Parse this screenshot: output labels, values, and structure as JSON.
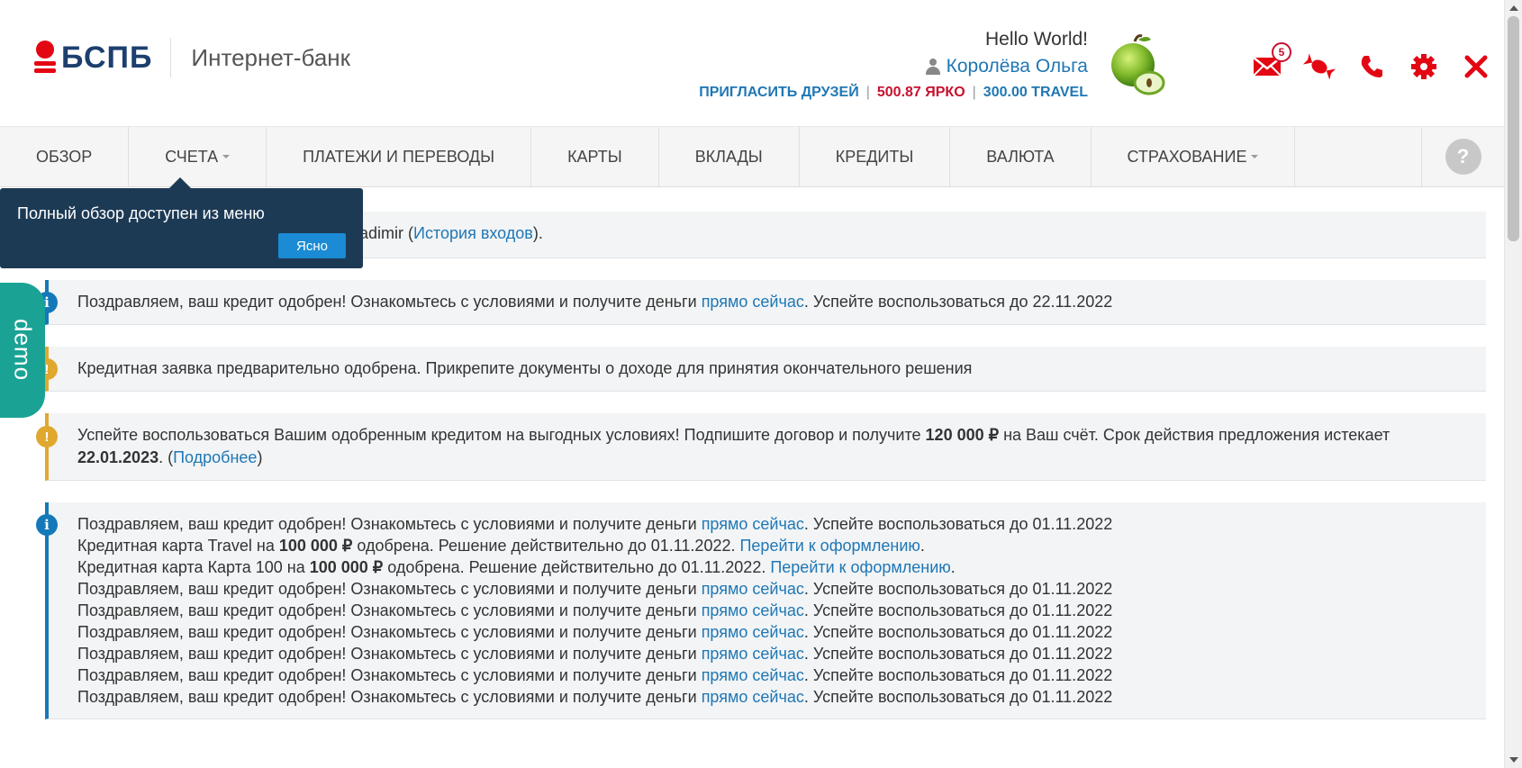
{
  "brand": {
    "logo_text": "БСПБ",
    "subtitle": "Интернет-банк"
  },
  "user": {
    "greeting": "Hello World!",
    "name": "Королёва Ольга",
    "invite_label": "ПРИГЛАСИТЬ ДРУЗЕЙ",
    "separator": "|",
    "yarko_balance": "500.87 ЯРКО",
    "travel_balance": "300.00 TRAVEL"
  },
  "toolbar": {
    "mail_badge": "5",
    "icons": [
      "mail-icon",
      "candy-icon",
      "phone-icon",
      "gear-icon",
      "close-icon"
    ],
    "accent_color": "#e30613"
  },
  "nav": {
    "items": [
      {
        "label": "ОБЗОР",
        "dropdown": false
      },
      {
        "label": "СЧЕТА",
        "dropdown": true
      },
      {
        "label": "ПЛАТЕЖИ И ПЕРЕВОДЫ",
        "dropdown": false
      },
      {
        "label": "КАРТЫ",
        "dropdown": false
      },
      {
        "label": "ВКЛАДЫ",
        "dropdown": false
      },
      {
        "label": "КРЕДИТЫ",
        "dropdown": false
      },
      {
        "label": "ВАЛЮТА",
        "dropdown": false
      },
      {
        "label": "СТРАХОВАНИЕ",
        "dropdown": true
      }
    ],
    "help": "?"
  },
  "tooltip": {
    "text": "Полный обзор доступен из меню",
    "button": "Ясно"
  },
  "demo_tab": "demo",
  "notices": {
    "login": {
      "visible_text": "adimir (",
      "link": "История входов",
      "after": ")."
    },
    "n1": {
      "pre": "Поздравляем, ваш кредит одобрен! Ознакомьтесь с условиями и получите деньги ",
      "link": "прямо сейчас",
      "post": ". Успейте воспользоваться до 22.11.2022"
    },
    "n2": {
      "text": "Кредитная заявка предварительно одобрена. Прикрепите документы о доходе для принятия окончательного решения"
    },
    "n3": {
      "pre": "Успейте воспользоваться Вашим одобренным кредитом на выгодных условиях! Подпишите договор и получите ",
      "amount": "120 000 ₽",
      "mid": " на Ваш счёт. Срок действия предложения истекает ",
      "date": "22.01.2023",
      "dot": ". (",
      "link": "Подробнее",
      "close": ")"
    },
    "n4": {
      "congrats_pre": "Поздравляем, ваш кредит одобрен! Ознакомьтесь с условиями и получите деньги ",
      "congrats_link": "прямо сейчас",
      "congrats_post": ". Успейте воспользоваться до 01.11.2022",
      "travel_pre": "Кредитная карта Travel на ",
      "travel_amount": "100 000 ₽",
      "travel_post": " одобрена. Решение действительно до 01.11.2022. ",
      "travel_link": "Перейти к оформлению",
      "card100_pre": "Кредитная карта Карта 100 на ",
      "card100_amount": "100 000 ₽",
      "card100_post": " одобрена. Решение действительно до 01.11.2022. ",
      "card100_link": "Перейти к оформлению",
      "period": "."
    }
  }
}
